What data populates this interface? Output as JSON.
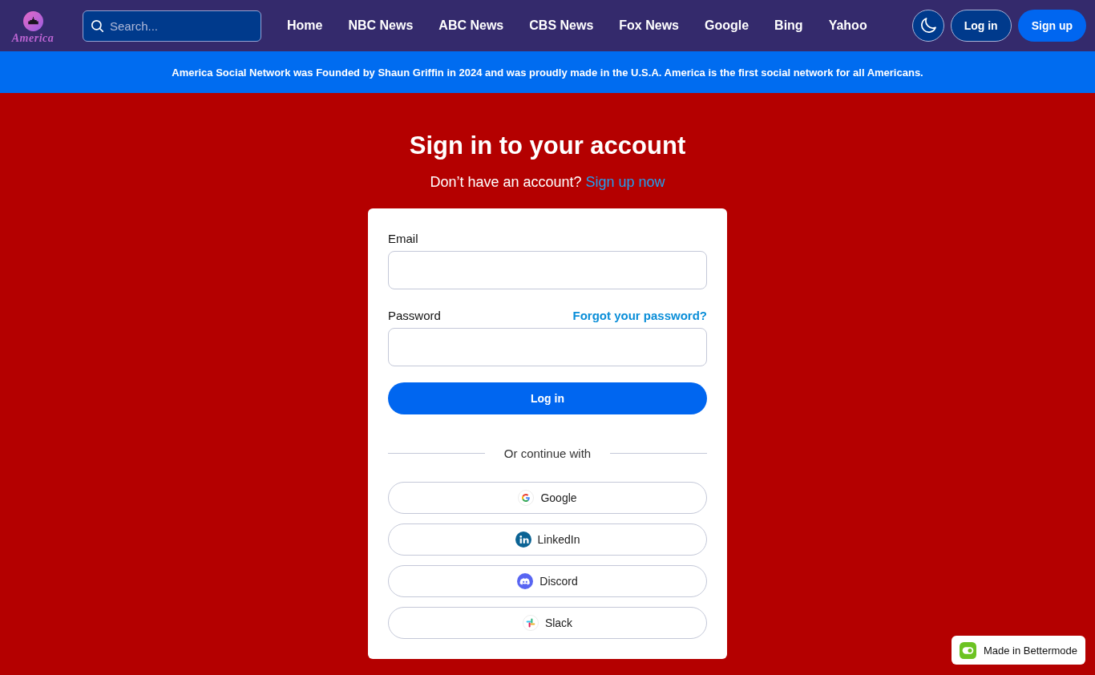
{
  "header": {
    "logo": {
      "text": "America"
    },
    "search": {
      "placeholder": "Search..."
    },
    "nav": [
      {
        "label": "Home"
      },
      {
        "label": "NBC News"
      },
      {
        "label": "ABC News"
      },
      {
        "label": "CBS News"
      },
      {
        "label": "Fox News"
      },
      {
        "label": "Google"
      },
      {
        "label": "Bing"
      },
      {
        "label": "Yahoo"
      }
    ],
    "login_button": "Log in",
    "signup_button": "Sign up"
  },
  "banner": {
    "text": "America Social Network was Founded by Shaun Griffin in 2024 and was proudly made in the U.S.A. America is the first social network for all Americans."
  },
  "signin": {
    "title": "Sign in to your account",
    "prompt": "Don’t have an account?",
    "signup_link": "Sign up now",
    "form": {
      "fields": [
        {
          "label": "Email"
        },
        {
          "label": "Password",
          "link": "Forgot your password?"
        }
      ],
      "submit": "Log in",
      "divider": "Or continue with",
      "providers": [
        {
          "name": "Google",
          "kind": "google"
        },
        {
          "name": "LinkedIn",
          "kind": "linkedin"
        },
        {
          "name": "Discord",
          "kind": "discord"
        },
        {
          "name": "Slack",
          "kind": "slack"
        }
      ]
    }
  },
  "badge": {
    "text": "Made in Bettermode"
  }
}
